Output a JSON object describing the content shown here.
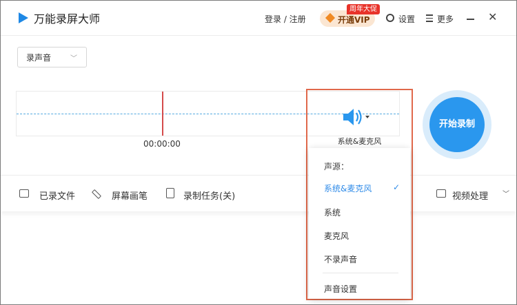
{
  "app": {
    "title": "万能录屏大师"
  },
  "header": {
    "login_label": "登录 / 注册",
    "vip_label": "开通VIP",
    "promo_badge": "周年大促",
    "settings_label": "设置",
    "more_label": "更多"
  },
  "source_select": {
    "value": "录声音"
  },
  "timer": "00:00:00",
  "audio": {
    "device_label": "系统&麦克风",
    "menu_title": "声源：",
    "options": [
      "系统&麦克风",
      "系统",
      "麦克风",
      "不录声音"
    ],
    "selected": "系统&麦克风",
    "settings_label": "声音设置"
  },
  "start_button": "开始录制",
  "bottom": {
    "recorded_files": "已录文件",
    "screen_pen": "屏幕画笔",
    "record_task": "录制任务(关)",
    "video_process": "视频处理"
  },
  "colors": {
    "accent": "#2a97ee",
    "highlight_border": "#e0684a",
    "vip_bg": "#fbe6d2",
    "promo": "#e8332a"
  },
  "icons": [
    "app-logo-icon",
    "vip-gem-icon",
    "settings-icon",
    "menu-icon",
    "minimize-icon",
    "close-icon",
    "speaker-icon",
    "check-icon",
    "camera-icon",
    "pen-icon",
    "clipboard-icon",
    "play-icon"
  ]
}
